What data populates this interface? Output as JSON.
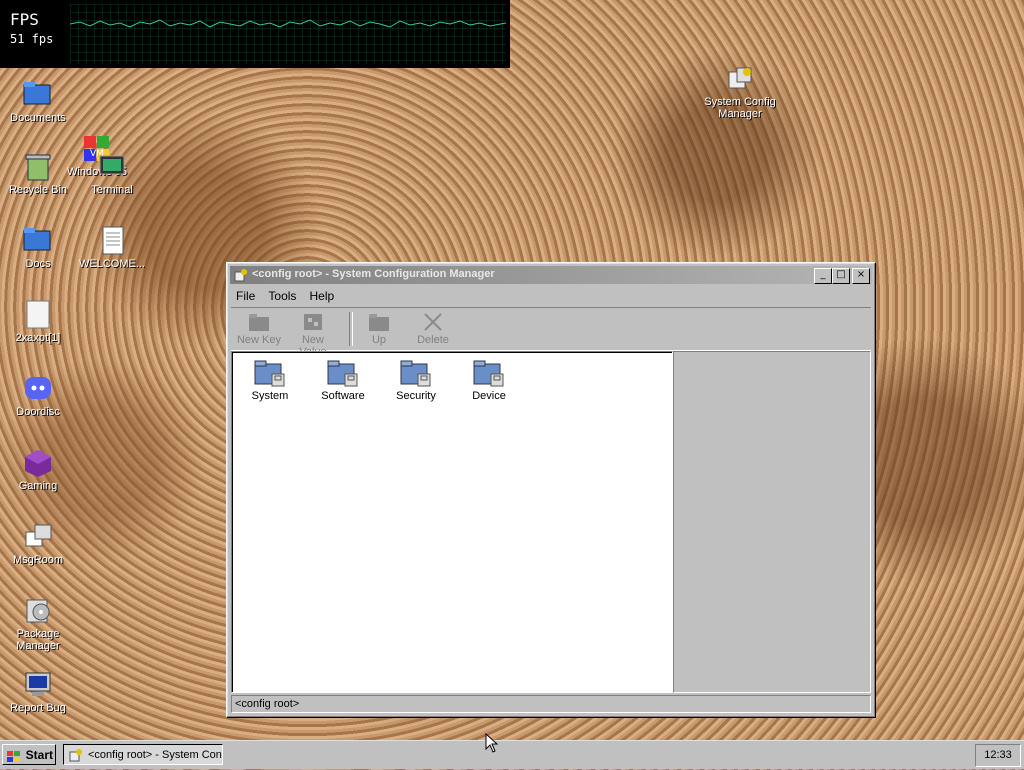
{
  "fps": {
    "label": "FPS",
    "value": "51 fps"
  },
  "desktop": {
    "icons": [
      {
        "label": "Documents"
      },
      {
        "label": "Recycle Bin"
      },
      {
        "label": "Windows 95"
      },
      {
        "label": "Terminal"
      },
      {
        "label": "Docs"
      },
      {
        "label": "WELCOME..."
      },
      {
        "label": "2xaxpt[1]"
      },
      {
        "label": "Doordisc"
      },
      {
        "label": "Gaming"
      },
      {
        "label": "MsgRoom"
      },
      {
        "label": "Package Manager"
      },
      {
        "label": "Report Bug"
      },
      {
        "label": "System Config Manager"
      }
    ]
  },
  "window": {
    "title": "<config root> - System Configuration Manager",
    "menu": [
      "File",
      "Tools",
      "Help"
    ],
    "toolbar": [
      "New Key",
      "New Value",
      "Up",
      "Delete"
    ],
    "keys": [
      "System",
      "Software",
      "Security",
      "Device"
    ],
    "status": "<config root>"
  },
  "taskbar": {
    "start_label": "Start",
    "task_label": "<config root> - System Con...",
    "clock": "12:33"
  }
}
